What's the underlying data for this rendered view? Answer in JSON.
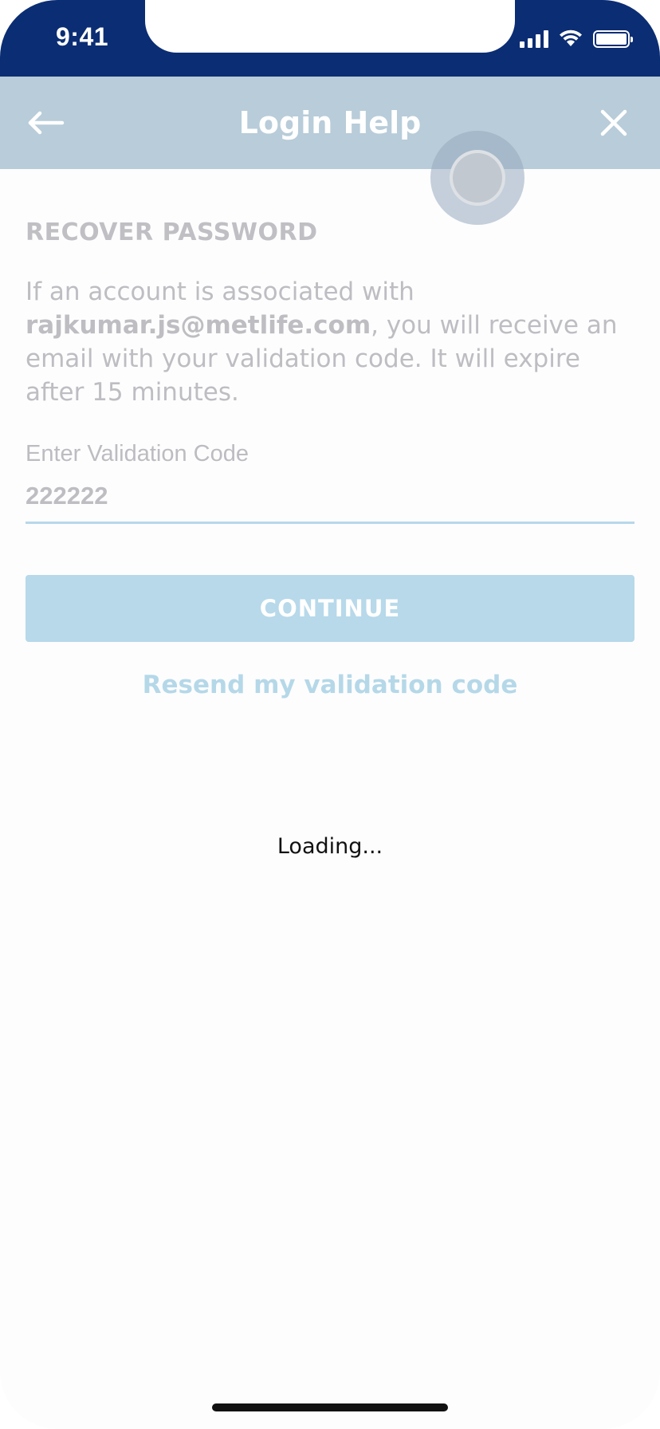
{
  "status_bar": {
    "time": "9:41",
    "background": "#0b2d73"
  },
  "header": {
    "title": "Login Help",
    "back_icon": "arrow-left-icon",
    "close_icon": "close-icon",
    "background": "#b8ccd9"
  },
  "recover": {
    "section_title": "RECOVER PASSWORD",
    "description_prefix": "If an account is associated with ",
    "email": "rajkumar.js@metlife.com",
    "description_suffix": ", you will receive an email with your validation code. It will expire after 15 minutes."
  },
  "validation": {
    "label": "Enter Validation Code",
    "value": "222222"
  },
  "actions": {
    "continue_label": "CONTINUE",
    "resend_label": "Resend my validation code"
  },
  "overlay": {
    "loading_text": "Loading..."
  },
  "colors": {
    "accent_light": "#b7d9ea",
    "text_muted": "#bdbdc2"
  }
}
